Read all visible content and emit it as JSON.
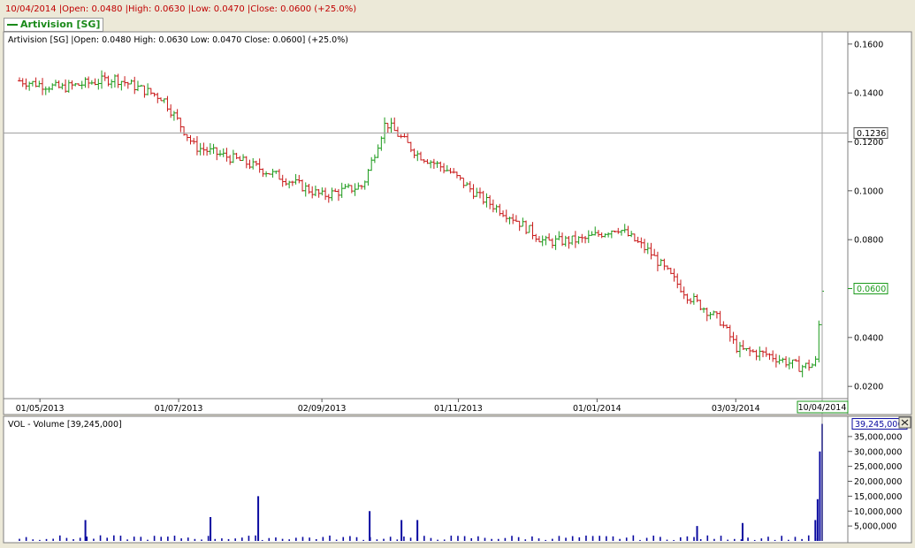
{
  "header": {
    "quote_line": "10/04/2014 |Open: 0.0480 |High: 0.0630 |Low: 0.0470 |Close: 0.0600 (+25.0%)",
    "legend_label": "Artivision [SG]"
  },
  "price_panel": {
    "info": "Artivision [SG] |Open: 0.0480  High: 0.0630  Low: 0.0470  Close: 0.0600] (+25.0%)",
    "crosshair_value": "0.1236",
    "last_value": "0.0600",
    "date_axis": [
      "01/05/2013",
      "01/07/2013",
      "02/09/2013",
      "01/11/2013",
      "01/01/2014",
      "03/03/2014"
    ],
    "cursor_date": "10/04/2014"
  },
  "volume_panel": {
    "label": "VOL - Volume [39,245,000]",
    "last_value": "39,245,000",
    "close_icon": "close-icon"
  },
  "colors": {
    "up": "#1a9a1a",
    "down": "#c81818",
    "volume": "#0a0aa0",
    "crosshair": "#a0a0a0"
  },
  "chart_data": [
    {
      "type": "line",
      "title": "Artivision [SG]",
      "series": [
        {
          "name": "Artivision [SG]",
          "x": [
            "2013-04-22",
            "2013-05-10",
            "2013-06-03",
            "2013-06-24",
            "2013-07-08",
            "2013-07-29",
            "2013-08-19",
            "2013-09-02",
            "2013-09-20",
            "2013-09-30",
            "2013-10-14",
            "2013-10-28",
            "2013-11-11",
            "2013-11-25",
            "2013-12-09",
            "2013-12-26",
            "2014-01-10",
            "2014-01-24",
            "2014-02-10",
            "2014-02-24",
            "2014-03-04",
            "2014-03-17",
            "2014-03-31",
            "2014-04-07",
            "2014-04-10"
          ],
          "values": [
            0.145,
            0.142,
            0.146,
            0.138,
            0.118,
            0.112,
            0.104,
            0.098,
            0.102,
            0.128,
            0.115,
            0.108,
            0.097,
            0.089,
            0.079,
            0.08,
            0.085,
            0.075,
            0.057,
            0.047,
            0.035,
            0.033,
            0.028,
            0.029,
            0.06
          ]
        }
      ],
      "ylim": [
        0.015,
        0.165
      ],
      "yticks": [
        "0.0200",
        "0.0400",
        "0.0600",
        "0.0800",
        "0.1000",
        "0.1200",
        "0.1400",
        "0.1600"
      ]
    },
    {
      "type": "bar",
      "title": "VOL - Volume",
      "series": [
        {
          "name": "Volume",
          "x": [
            "2013-05-21",
            "2013-07-15",
            "2013-08-05",
            "2013-09-23",
            "2013-10-07",
            "2013-10-14",
            "2014-02-14",
            "2014-03-06",
            "2014-04-07",
            "2014-04-08",
            "2014-04-09",
            "2014-04-10"
          ],
          "values": [
            7000000,
            8000000,
            15000000,
            10000000,
            7000000,
            7000000,
            5000000,
            6000000,
            7000000,
            14000000,
            30000000,
            39245000
          ]
        }
      ],
      "ylim": [
        0,
        40000000
      ],
      "yticks": [
        "5,000,000",
        "10,000,000",
        "15,000,000",
        "20,000,000",
        "25,000,000",
        "30,000,000",
        "35,000,000"
      ]
    }
  ]
}
